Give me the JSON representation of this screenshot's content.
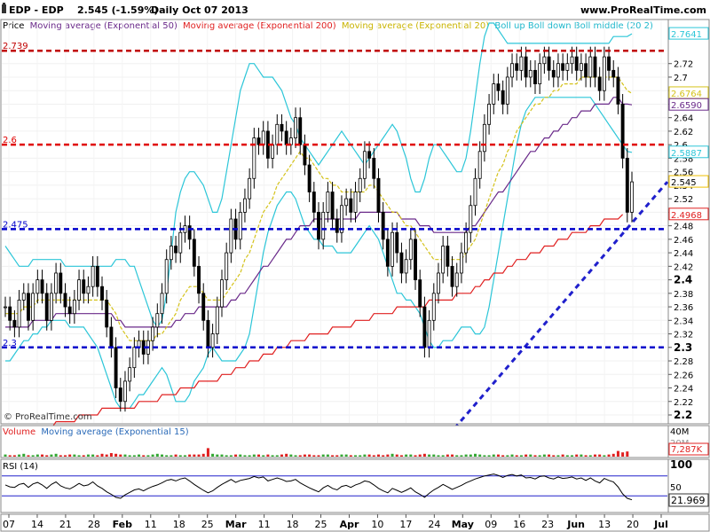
{
  "header": {
    "title": "EDP - EDP",
    "quote": "2.545 (-1.59%)",
    "period": "Daily  Oct 07 2013",
    "site": "www.ProRealTime.com"
  },
  "legend": {
    "items": [
      {
        "label": "Price",
        "color": "#000000"
      },
      {
        "label": "Moving average (Exponential 50)",
        "color": "#6a2a8a"
      },
      {
        "label": "Moving average (Exponential 200)",
        "color": "#e02020"
      },
      {
        "label": "Moving average (Exponential 20)",
        "color": "#d4c21a"
      },
      {
        "label": "Boll up Boll down Boll middle (20 2)",
        "color": "#2cc6d8"
      }
    ]
  },
  "watermark": "© ProRealTime.com",
  "hlines": [
    {
      "value": 2.739,
      "label": "2.739",
      "color": "#c00000"
    },
    {
      "value": 2.6,
      "label": "2.6",
      "color": "#e00000"
    },
    {
      "value": 2.475,
      "label": "2.475",
      "color": "#0000cc"
    },
    {
      "value": 2.3,
      "label": "2.3",
      "color": "#0000cc"
    }
  ],
  "price_badges": [
    {
      "value": 2.7641,
      "label": "2.7641",
      "color": "#2cc6d8"
    },
    {
      "value": 2.6764,
      "label": "2.6764",
      "color": "#d4c21a"
    },
    {
      "value": 2.659,
      "label": "2.6590",
      "color": "#6a2a8a"
    },
    {
      "value": 2.5887,
      "label": "2.5887",
      "color": "#2cc6d8"
    },
    {
      "value": 2.545,
      "label": "2.545",
      "color": "#f0c000"
    },
    {
      "value": 2.4968,
      "label": "2.4968",
      "color": "#e02020"
    }
  ],
  "volume_panel": {
    "label_a": "Volume",
    "label_b": "Moving average (Exponential 15)",
    "axis_top": "40M",
    "axis_mid": "20M",
    "value_badge": "7,287K"
  },
  "rsi_panel": {
    "label": "RSI (14)",
    "axis_top": "100",
    "axis_mid": "50",
    "value_badge": "21.969",
    "levels": [
      70,
      30
    ]
  },
  "x_axis": [
    {
      "label": "07",
      "bold": false
    },
    {
      "label": "14",
      "bold": false
    },
    {
      "label": "21",
      "bold": false
    },
    {
      "label": "28",
      "bold": false
    },
    {
      "label": "Feb",
      "bold": true
    },
    {
      "label": "11",
      "bold": false
    },
    {
      "label": "18",
      "bold": false
    },
    {
      "label": "25",
      "bold": false
    },
    {
      "label": "Mar",
      "bold": true
    },
    {
      "label": "11",
      "bold": false
    },
    {
      "label": "18",
      "bold": false
    },
    {
      "label": "25",
      "bold": false
    },
    {
      "label": "Apr",
      "bold": true
    },
    {
      "label": "10",
      "bold": false
    },
    {
      "label": "17",
      "bold": false
    },
    {
      "label": "24",
      "bold": false
    },
    {
      "label": "May",
      "bold": true
    },
    {
      "label": "09",
      "bold": false
    },
    {
      "label": "16",
      "bold": false
    },
    {
      "label": "23",
      "bold": false
    },
    {
      "label": "Jun",
      "bold": true
    },
    {
      "label": "13",
      "bold": false
    },
    {
      "label": "20",
      "bold": false
    },
    {
      "label": "Jul",
      "bold": true
    }
  ],
  "chart_data": {
    "type": "candlestick",
    "ylim": [
      2.2,
      2.78
    ],
    "y_ticks": [
      2.2,
      2.22,
      2.24,
      2.26,
      2.28,
      2.3,
      2.32,
      2.34,
      2.36,
      2.38,
      2.4,
      2.42,
      2.44,
      2.46,
      2.48,
      2.5,
      2.52,
      2.54,
      2.56,
      2.58,
      2.6,
      2.62,
      2.64,
      2.66,
      2.68,
      2.7,
      2.72
    ],
    "y_tick_labels": [
      "2.2",
      "2.22",
      "2.24",
      "2.26",
      "2.28",
      "2.3",
      "2.32",
      "2.34",
      "2.36",
      "2.38",
      "2.4",
      "2.42",
      "2.44",
      "2.46",
      "2.48",
      "2.5",
      "2.52",
      "2.54",
      "2.56",
      "2.58",
      "2.6",
      "2.62",
      "2.64",
      "2.66",
      "2.68",
      "2.7",
      "2.72"
    ],
    "x_dates": [
      "Jan 07",
      "Jan 14",
      "Jan 21",
      "Jan 28",
      "Feb",
      "Feb 11",
      "Feb 18",
      "Feb 25",
      "Mar",
      "Mar 11",
      "Mar 18",
      "Mar 25",
      "Apr",
      "Apr 10",
      "Apr 17",
      "Apr 24",
      "May",
      "May 09",
      "May 16",
      "May 23",
      "Jun",
      "Jun 13",
      "Jun 20",
      "Jul"
    ],
    "close": [
      2.36,
      2.34,
      2.33,
      2.37,
      2.38,
      2.34,
      2.38,
      2.4,
      2.38,
      2.34,
      2.38,
      2.41,
      2.38,
      2.36,
      2.35,
      2.37,
      2.4,
      2.38,
      2.39,
      2.42,
      2.39,
      2.37,
      2.33,
      2.3,
      2.24,
      2.22,
      2.25,
      2.27,
      2.3,
      2.31,
      2.29,
      2.31,
      2.33,
      2.35,
      2.38,
      2.43,
      2.45,
      2.44,
      2.47,
      2.48,
      2.46,
      2.42,
      2.38,
      2.34,
      2.3,
      2.32,
      2.36,
      2.4,
      2.44,
      2.49,
      2.46,
      2.5,
      2.52,
      2.55,
      2.61,
      2.6,
      2.62,
      2.58,
      2.6,
      2.63,
      2.62,
      2.6,
      2.61,
      2.64,
      2.6,
      2.57,
      2.53,
      2.5,
      2.46,
      2.5,
      2.53,
      2.49,
      2.47,
      2.51,
      2.52,
      2.5,
      2.53,
      2.55,
      2.59,
      2.58,
      2.55,
      2.5,
      2.46,
      2.42,
      2.47,
      2.44,
      2.41,
      2.43,
      2.46,
      2.4,
      2.36,
      2.3,
      2.34,
      2.38,
      2.41,
      2.45,
      2.42,
      2.39,
      2.41,
      2.44,
      2.47,
      2.51,
      2.55,
      2.59,
      2.63,
      2.66,
      2.69,
      2.68,
      2.66,
      2.7,
      2.72,
      2.71,
      2.73,
      2.7,
      2.71,
      2.69,
      2.72,
      2.73,
      2.71,
      2.7,
      2.72,
      2.71,
      2.72,
      2.73,
      2.71,
      2.72,
      2.7,
      2.73,
      2.7,
      2.68,
      2.73,
      2.71,
      2.7,
      2.66,
      2.58,
      2.5,
      2.545
    ],
    "ema20": [
      2.35,
      2.35,
      2.35,
      2.35,
      2.36,
      2.36,
      2.36,
      2.37,
      2.37,
      2.37,
      2.37,
      2.37,
      2.37,
      2.37,
      2.37,
      2.37,
      2.37,
      2.37,
      2.37,
      2.37,
      2.37,
      2.37,
      2.37,
      2.36,
      2.35,
      2.33,
      2.32,
      2.31,
      2.31,
      2.31,
      2.31,
      2.31,
      2.31,
      2.32,
      2.32,
      2.33,
      2.34,
      2.35,
      2.37,
      2.38,
      2.39,
      2.39,
      2.39,
      2.38,
      2.37,
      2.37,
      2.37,
      2.37,
      2.38,
      2.39,
      2.4,
      2.41,
      2.43,
      2.44,
      2.46,
      2.48,
      2.5,
      2.51,
      2.52,
      2.54,
      2.55,
      2.56,
      2.57,
      2.58,
      2.59,
      2.58,
      2.58,
      2.57,
      2.56,
      2.55,
      2.55,
      2.54,
      2.54,
      2.53,
      2.53,
      2.53,
      2.53,
      2.53,
      2.53,
      2.54,
      2.54,
      2.53,
      2.52,
      2.51,
      2.5,
      2.5,
      2.49,
      2.48,
      2.48,
      2.47,
      2.46,
      2.45,
      2.44,
      2.43,
      2.43,
      2.43,
      2.43,
      2.43,
      2.43,
      2.43,
      2.44,
      2.45,
      2.46,
      2.48,
      2.5,
      2.52,
      2.54,
      2.56,
      2.57,
      2.59,
      2.6,
      2.62,
      2.63,
      2.64,
      2.65,
      2.66,
      2.66,
      2.67,
      2.67,
      2.68,
      2.68,
      2.69,
      2.69,
      2.69,
      2.69,
      2.7,
      2.7,
      2.7,
      2.7,
      2.7,
      2.7,
      2.7,
      2.7,
      2.7,
      2.69,
      2.68,
      2.676
    ],
    "ema50": [
      2.33,
      2.33,
      2.33,
      2.33,
      2.33,
      2.33,
      2.34,
      2.34,
      2.34,
      2.34,
      2.34,
      2.35,
      2.35,
      2.35,
      2.35,
      2.35,
      2.35,
      2.35,
      2.35,
      2.35,
      2.35,
      2.35,
      2.35,
      2.35,
      2.34,
      2.34,
      2.33,
      2.33,
      2.33,
      2.33,
      2.33,
      2.33,
      2.33,
      2.33,
      2.33,
      2.33,
      2.33,
      2.34,
      2.34,
      2.35,
      2.35,
      2.35,
      2.36,
      2.36,
      2.36,
      2.36,
      2.36,
      2.36,
      2.36,
      2.37,
      2.37,
      2.38,
      2.38,
      2.39,
      2.4,
      2.41,
      2.42,
      2.42,
      2.43,
      2.44,
      2.45,
      2.46,
      2.46,
      2.47,
      2.48,
      2.48,
      2.48,
      2.49,
      2.49,
      2.49,
      2.49,
      2.49,
      2.49,
      2.49,
      2.49,
      2.49,
      2.49,
      2.5,
      2.5,
      2.5,
      2.5,
      2.5,
      2.5,
      2.5,
      2.5,
      2.5,
      2.49,
      2.49,
      2.49,
      2.49,
      2.48,
      2.48,
      2.48,
      2.47,
      2.47,
      2.47,
      2.47,
      2.47,
      2.47,
      2.47,
      2.47,
      2.48,
      2.48,
      2.49,
      2.5,
      2.51,
      2.52,
      2.53,
      2.53,
      2.54,
      2.55,
      2.56,
      2.57,
      2.58,
      2.59,
      2.59,
      2.6,
      2.61,
      2.61,
      2.62,
      2.62,
      2.63,
      2.63,
      2.64,
      2.64,
      2.65,
      2.65,
      2.65,
      2.66,
      2.66,
      2.66,
      2.66,
      2.67,
      2.67,
      2.66,
      2.66,
      2.659
    ],
    "ema200": [
      2.17,
      2.17,
      2.17,
      2.17,
      2.17,
      2.17,
      2.18,
      2.18,
      2.18,
      2.18,
      2.18,
      2.19,
      2.19,
      2.19,
      2.19,
      2.19,
      2.2,
      2.2,
      2.2,
      2.2,
      2.2,
      2.21,
      2.21,
      2.21,
      2.21,
      2.21,
      2.21,
      2.21,
      2.21,
      2.22,
      2.22,
      2.22,
      2.22,
      2.22,
      2.23,
      2.23,
      2.23,
      2.23,
      2.24,
      2.24,
      2.24,
      2.24,
      2.25,
      2.25,
      2.25,
      2.25,
      2.25,
      2.26,
      2.26,
      2.26,
      2.27,
      2.27,
      2.27,
      2.28,
      2.28,
      2.28,
      2.29,
      2.29,
      2.29,
      2.3,
      2.3,
      2.3,
      2.31,
      2.31,
      2.31,
      2.31,
      2.32,
      2.32,
      2.32,
      2.32,
      2.32,
      2.33,
      2.33,
      2.33,
      2.33,
      2.33,
      2.34,
      2.34,
      2.34,
      2.34,
      2.35,
      2.35,
      2.35,
      2.35,
      2.35,
      2.36,
      2.36,
      2.36,
      2.36,
      2.36,
      2.36,
      2.36,
      2.37,
      2.37,
      2.37,
      2.37,
      2.37,
      2.37,
      2.38,
      2.38,
      2.38,
      2.38,
      2.39,
      2.39,
      2.4,
      2.4,
      2.41,
      2.41,
      2.41,
      2.42,
      2.42,
      2.43,
      2.43,
      2.43,
      2.44,
      2.44,
      2.44,
      2.45,
      2.45,
      2.45,
      2.46,
      2.46,
      2.46,
      2.47,
      2.47,
      2.47,
      2.47,
      2.48,
      2.48,
      2.48,
      2.49,
      2.49,
      2.49,
      2.49,
      2.4968
    ],
    "boll_up": [
      2.45,
      2.44,
      2.43,
      2.42,
      2.42,
      2.42,
      2.43,
      2.43,
      2.43,
      2.43,
      2.43,
      2.43,
      2.43,
      2.42,
      2.42,
      2.42,
      2.42,
      2.42,
      2.42,
      2.42,
      2.42,
      2.42,
      2.42,
      2.42,
      2.43,
      2.43,
      2.43,
      2.42,
      2.42,
      2.4,
      2.38,
      2.36,
      2.34,
      2.33,
      2.34,
      2.38,
      2.44,
      2.5,
      2.53,
      2.55,
      2.56,
      2.56,
      2.55,
      2.54,
      2.52,
      2.5,
      2.5,
      2.52,
      2.56,
      2.6,
      2.64,
      2.68,
      2.7,
      2.72,
      2.72,
      2.71,
      2.7,
      2.7,
      2.7,
      2.69,
      2.68,
      2.66,
      2.64,
      2.63,
      2.61,
      2.6,
      2.59,
      2.58,
      2.57,
      2.58,
      2.59,
      2.6,
      2.61,
      2.62,
      2.61,
      2.6,
      2.59,
      2.58,
      2.57,
      2.58,
      2.59,
      2.6,
      2.61,
      2.62,
      2.63,
      2.62,
      2.6,
      2.58,
      2.55,
      2.53,
      2.53,
      2.55,
      2.58,
      2.6,
      2.6,
      2.59,
      2.58,
      2.57,
      2.56,
      2.56,
      2.58,
      2.62,
      2.67,
      2.72,
      2.76,
      2.78,
      2.78,
      2.77,
      2.76,
      2.75,
      2.75,
      2.75,
      2.75,
      2.75,
      2.75,
      2.75,
      2.75,
      2.75,
      2.75,
      2.75,
      2.75,
      2.75,
      2.75,
      2.75,
      2.75,
      2.75,
      2.75,
      2.75,
      2.75,
      2.75,
      2.75,
      2.75,
      2.76,
      2.76,
      2.76,
      2.76,
      2.7641
    ],
    "boll_down": [
      2.28,
      2.28,
      2.29,
      2.3,
      2.31,
      2.31,
      2.32,
      2.32,
      2.33,
      2.33,
      2.34,
      2.34,
      2.34,
      2.34,
      2.33,
      2.33,
      2.33,
      2.33,
      2.32,
      2.31,
      2.3,
      2.28,
      2.26,
      2.24,
      2.22,
      2.21,
      2.21,
      2.21,
      2.22,
      2.23,
      2.23,
      2.24,
      2.25,
      2.26,
      2.27,
      2.26,
      2.24,
      2.22,
      2.22,
      2.22,
      2.23,
      2.25,
      2.26,
      2.27,
      2.29,
      2.3,
      2.29,
      2.28,
      2.28,
      2.28,
      2.28,
      2.29,
      2.3,
      2.32,
      2.36,
      2.4,
      2.44,
      2.47,
      2.49,
      2.51,
      2.52,
      2.53,
      2.53,
      2.52,
      2.5,
      2.48,
      2.47,
      2.46,
      2.46,
      2.45,
      2.45,
      2.45,
      2.44,
      2.44,
      2.44,
      2.44,
      2.45,
      2.46,
      2.47,
      2.48,
      2.47,
      2.46,
      2.44,
      2.42,
      2.4,
      2.38,
      2.38,
      2.37,
      2.37,
      2.36,
      2.35,
      2.33,
      2.31,
      2.3,
      2.3,
      2.31,
      2.31,
      2.31,
      2.32,
      2.33,
      2.33,
      2.33,
      2.32,
      2.32,
      2.33,
      2.36,
      2.4,
      2.44,
      2.48,
      2.52,
      2.56,
      2.6,
      2.63,
      2.65,
      2.66,
      2.67,
      2.67,
      2.67,
      2.67,
      2.67,
      2.67,
      2.67,
      2.67,
      2.67,
      2.67,
      2.67,
      2.67,
      2.67,
      2.66,
      2.65,
      2.64,
      2.63,
      2.62,
      2.61,
      2.6,
      2.59,
      2.5887
    ],
    "trendline": {
      "from": {
        "index": 47,
        "value": 2.18
      },
      "to": {
        "index": 140,
        "value": 2.54
      }
    },
    "volume_m": [
      3,
      2,
      2,
      3,
      4,
      2,
      2,
      3,
      3,
      2,
      3,
      4,
      2,
      2,
      3,
      3,
      2,
      2,
      3,
      3,
      2,
      4,
      3,
      5,
      4,
      3,
      3,
      2,
      2,
      3,
      2,
      2,
      3,
      4,
      3,
      2,
      2,
      3,
      2,
      2,
      3,
      3,
      3,
      4,
      12,
      4,
      3,
      3,
      2,
      2,
      3,
      3,
      2,
      2,
      3,
      3,
      2,
      3,
      2,
      2,
      3,
      4,
      3,
      2,
      2,
      3,
      3,
      2,
      2,
      3,
      3,
      2,
      2,
      3,
      3,
      2,
      2,
      2,
      3,
      3,
      2,
      3,
      2,
      3,
      4,
      3,
      2,
      3,
      3,
      2,
      3,
      4,
      3,
      3,
      2,
      2,
      3,
      3,
      2,
      2,
      3,
      3,
      4,
      3,
      2,
      2,
      3,
      3,
      2,
      2,
      3,
      2,
      2,
      3,
      3,
      2,
      2,
      3,
      3,
      2,
      2,
      3,
      2,
      2,
      3,
      3,
      2,
      2,
      3,
      3,
      2,
      3,
      4,
      8,
      6,
      7.287
    ],
    "rsi": [
      52,
      48,
      47,
      53,
      55,
      47,
      54,
      57,
      52,
      45,
      53,
      58,
      50,
      46,
      44,
      49,
      55,
      50,
      52,
      58,
      50,
      45,
      38,
      33,
      27,
      25,
      32,
      37,
      42,
      44,
      40,
      45,
      49,
      52,
      56,
      61,
      63,
      60,
      64,
      66,
      60,
      53,
      47,
      41,
      36,
      40,
      47,
      53,
      58,
      63,
      57,
      61,
      63,
      65,
      69,
      66,
      68,
      60,
      63,
      66,
      63,
      59,
      60,
      63,
      56,
      51,
      46,
      42,
      38,
      46,
      51,
      45,
      42,
      49,
      51,
      47,
      52,
      55,
      60,
      58,
      52,
      45,
      40,
      36,
      45,
      41,
      37,
      41,
      46,
      38,
      33,
      27,
      35,
      42,
      47,
      53,
      48,
      43,
      47,
      51,
      56,
      60,
      64,
      67,
      70,
      72,
      74,
      71,
      67,
      71,
      73,
      70,
      72,
      66,
      67,
      64,
      69,
      70,
      66,
      64,
      68,
      65,
      66,
      68,
      64,
      66,
      61,
      66,
      60,
      56,
      65,
      61,
      58,
      48,
      34,
      25,
      21.969
    ]
  }
}
